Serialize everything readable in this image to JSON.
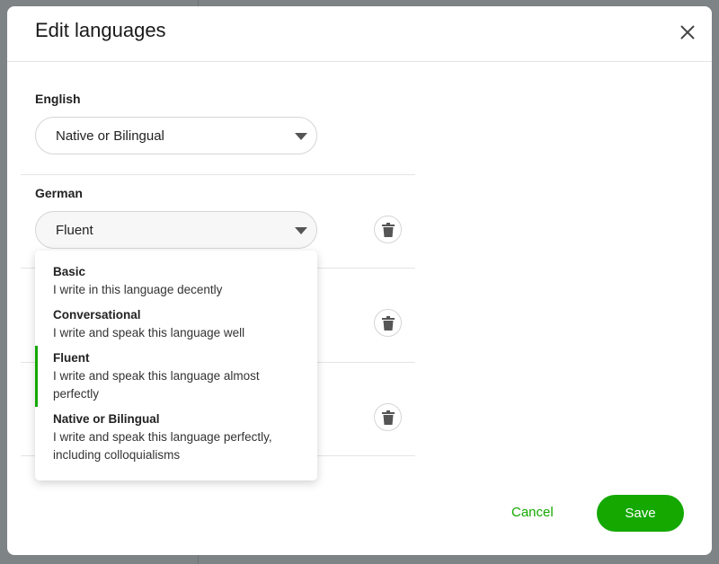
{
  "dialog": {
    "title": "Edit languages",
    "close_icon": "close-icon"
  },
  "languages": [
    {
      "name": "English",
      "proficiency": "Native or Bilingual",
      "deletable": false
    },
    {
      "name": "German",
      "proficiency": "Fluent",
      "deletable": true,
      "dropdown_open": true
    }
  ],
  "dropdown": {
    "options": [
      {
        "name": "Basic",
        "description": "I write in this language decently"
      },
      {
        "name": "Conversational",
        "description": "I write and speak this language well"
      },
      {
        "name": "Fluent",
        "description": "I write and speak this language almost perfectly",
        "selected": true
      },
      {
        "name": "Native or Bilingual",
        "description": "I write and speak this language perfectly, including colloquialisms"
      }
    ]
  },
  "footer": {
    "cancel_label": "Cancel",
    "save_label": "Save"
  },
  "colors": {
    "accent": "#14a800",
    "overlay": "#7e8385"
  }
}
